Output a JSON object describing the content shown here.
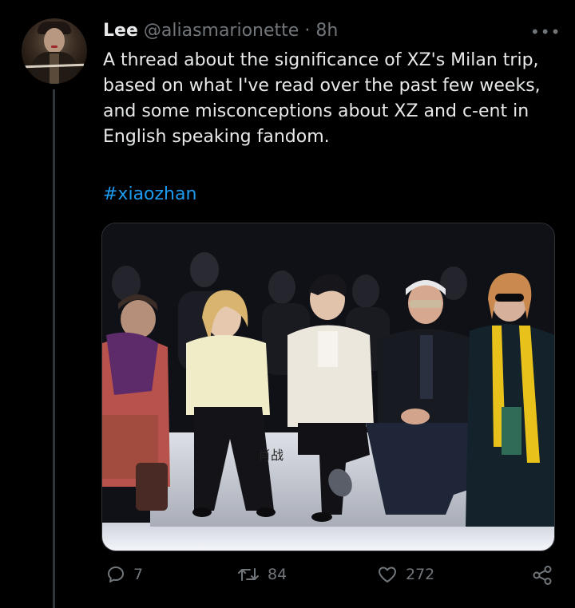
{
  "tweet": {
    "author_name": "Lee",
    "author_handle": "@aliasmarionette",
    "separator": "·",
    "time": "8h",
    "more_label": "•••",
    "text": "A thread about the significance of XZ's Milan trip, based on what I've read over the past few weeks, and some misconceptions about XZ and c-ent in English speaking fandom.",
    "hashtag": "#xiaozhan"
  },
  "media": {
    "signature_text": "肖战"
  },
  "actions": {
    "reply_count": "7",
    "retweet_count": "84",
    "like_count": "272"
  },
  "colors": {
    "background": "#000000",
    "text": "#e7e9ea",
    "muted": "#71767b",
    "link": "#1d9bf0",
    "thread_line": "#333639"
  },
  "icons": [
    "reply-icon",
    "retweet-icon",
    "like-icon",
    "share-icon",
    "more-icon"
  ]
}
